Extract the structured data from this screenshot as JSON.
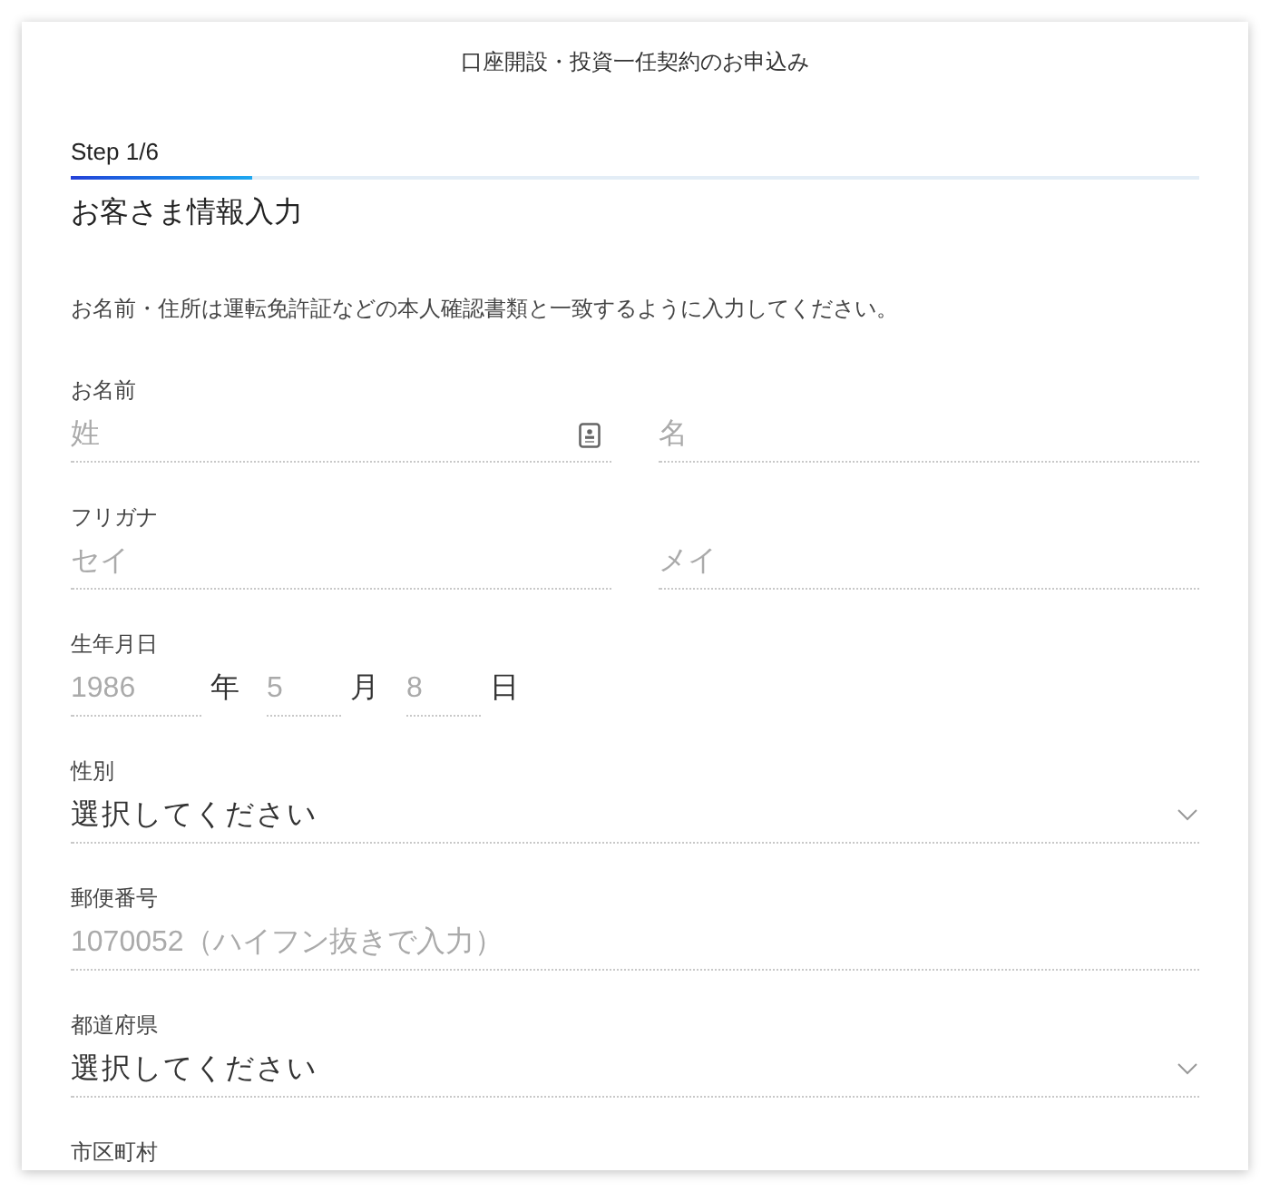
{
  "header": {
    "title": "口座開設・投資一任契約のお申込み"
  },
  "progress": {
    "label": "Step 1/6",
    "level": 0.16
  },
  "section": {
    "title": "お客さま情報入力",
    "note": "お名前・住所は運転免許証などの本人確認書類と一致するように入力してください。"
  },
  "fields": [
    {
      "kind": "pair",
      "label": "お名前",
      "inputs": [
        {
          "placeholder": "姓",
          "card_icon": true
        },
        {
          "placeholder": "名",
          "card_icon": false
        }
      ]
    },
    {
      "kind": "pair",
      "label": "フリガナ",
      "inputs": [
        {
          "placeholder": "セイ",
          "card_icon": false
        },
        {
          "placeholder": "メイ",
          "card_icon": false
        }
      ]
    },
    {
      "kind": "date",
      "label": "生年月日",
      "parts": [
        {
          "placeholder": "1986",
          "unit": "年"
        },
        {
          "placeholder": "5",
          "unit": "月"
        },
        {
          "placeholder": "8",
          "unit": "日"
        }
      ]
    },
    {
      "kind": "select",
      "label": "性別",
      "value": "選択してください"
    },
    {
      "kind": "text",
      "label": "郵便番号",
      "placeholder": "1070052（ハイフン抜きで入力）"
    },
    {
      "kind": "select",
      "label": "都道府県",
      "value": "選択してください"
    },
    {
      "kind": "label",
      "label": "市区町村"
    }
  ]
}
